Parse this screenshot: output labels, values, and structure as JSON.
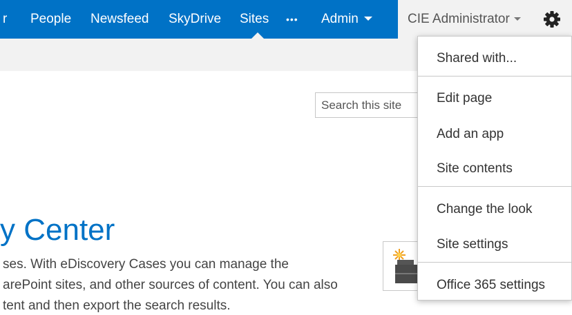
{
  "suite_bar": {
    "nav_items": [
      {
        "label": "r"
      },
      {
        "label": "People"
      },
      {
        "label": "Newsfeed"
      },
      {
        "label": "SkyDrive"
      },
      {
        "label": "Sites"
      },
      {
        "label": "•••"
      },
      {
        "label": "Admin"
      }
    ],
    "active_item": "Sites",
    "user_name": "CIE Administrator",
    "settings_icon": "gear-icon",
    "colors": {
      "bar": "#0072c6",
      "user_area": "#f2f2f2"
    }
  },
  "search": {
    "placeholder": "Search this site"
  },
  "page": {
    "title": "y Center",
    "description_lines": [
      "ses. With eDiscovery Cases you can manage the",
      "arePoint sites, and other sources of content. You can also",
      "tent and then export the search results."
    ],
    "tile_icon": "briefcase-sparkle-icon"
  },
  "settings_menu": {
    "items": [
      {
        "label": "Shared with..."
      },
      {
        "label": "Edit page"
      },
      {
        "label": "Add an app"
      },
      {
        "label": "Site contents"
      },
      {
        "label": "Change the look"
      },
      {
        "label": "Site settings"
      },
      {
        "label": "Office 365 settings"
      }
    ]
  }
}
